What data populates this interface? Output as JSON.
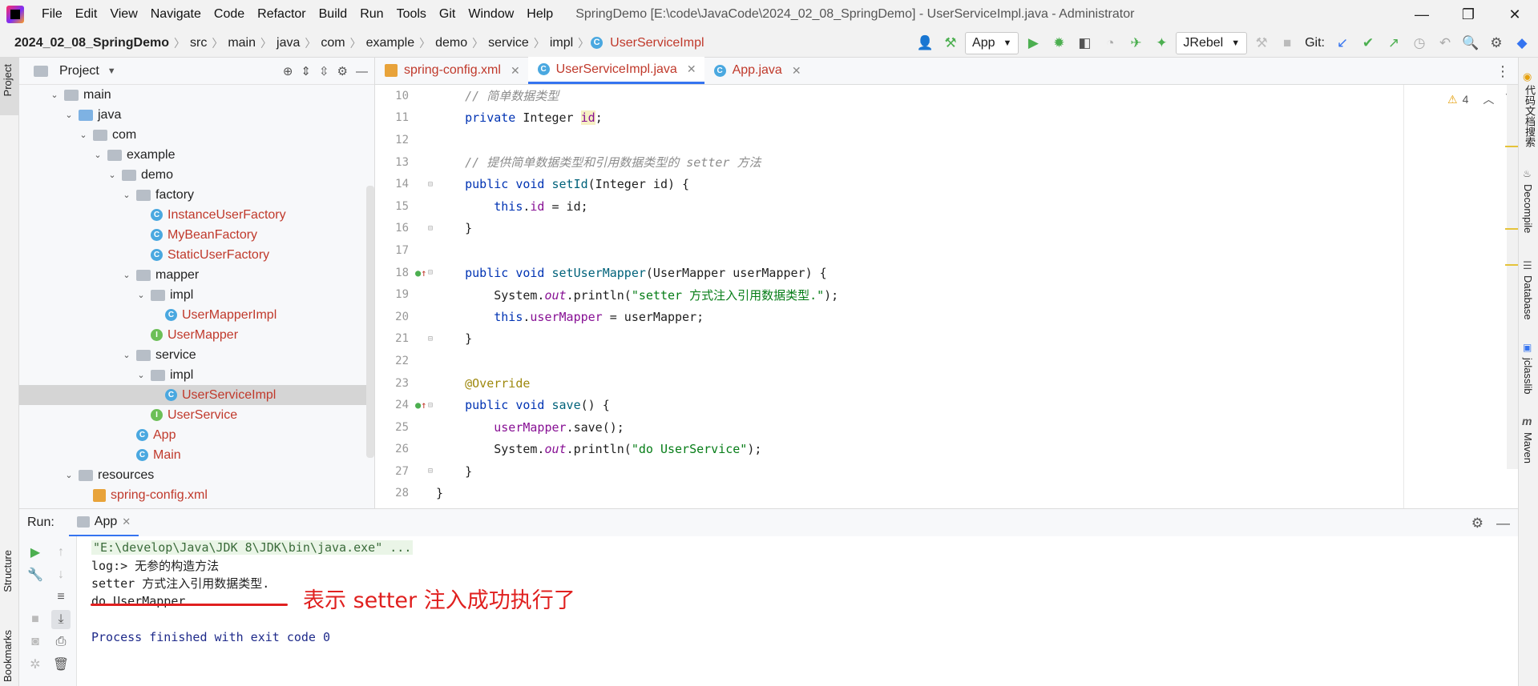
{
  "menu": [
    "File",
    "Edit",
    "View",
    "Navigate",
    "Code",
    "Refactor",
    "Build",
    "Run",
    "Tools",
    "Git",
    "Window",
    "Help"
  ],
  "window_title": "SpringDemo [E:\\code\\JavaCode\\2024_02_08_SpringDemo] - UserServiceImpl.java - Administrator",
  "window_controls": {
    "minimize": "—",
    "restore": "❐",
    "close": "✕"
  },
  "breadcrumb": [
    "2024_02_08_SpringDemo",
    "src",
    "main",
    "java",
    "com",
    "example",
    "demo",
    "service",
    "impl",
    "UserServiceImpl"
  ],
  "toolbar": {
    "run_config": "App",
    "jrebel": "JRebel",
    "git_label": "Git:"
  },
  "project_panel": {
    "title": "Project",
    "tree": [
      {
        "label": "main",
        "type": "folder",
        "level": 1,
        "expanded": true
      },
      {
        "label": "java",
        "type": "folder-blue",
        "level": 2,
        "expanded": true
      },
      {
        "label": "com",
        "type": "folder",
        "level": 3,
        "expanded": true
      },
      {
        "label": "example",
        "type": "folder",
        "level": 4,
        "expanded": true
      },
      {
        "label": "demo",
        "type": "folder",
        "level": 5,
        "expanded": true
      },
      {
        "label": "factory",
        "type": "folder",
        "level": 6,
        "expanded": true
      },
      {
        "label": "InstanceUserFactory",
        "type": "class",
        "level": 7
      },
      {
        "label": "MyBeanFactory",
        "type": "class",
        "level": 7
      },
      {
        "label": "StaticUserFactory",
        "type": "class",
        "level": 7
      },
      {
        "label": "mapper",
        "type": "folder",
        "level": 6,
        "expanded": true
      },
      {
        "label": "impl",
        "type": "folder",
        "level": 7,
        "expanded": true
      },
      {
        "label": "UserMapperImpl",
        "type": "class",
        "level": 8
      },
      {
        "label": "UserMapper",
        "type": "interface",
        "level": 7
      },
      {
        "label": "service",
        "type": "folder",
        "level": 6,
        "expanded": true
      },
      {
        "label": "impl",
        "type": "folder",
        "level": 7,
        "expanded": true
      },
      {
        "label": "UserServiceImpl",
        "type": "class",
        "level": 8,
        "selected": true
      },
      {
        "label": "UserService",
        "type": "interface",
        "level": 7
      },
      {
        "label": "App",
        "type": "class-main",
        "level": 6
      },
      {
        "label": "Main",
        "type": "class-main",
        "level": 6
      },
      {
        "label": "resources",
        "type": "folder",
        "level": 2,
        "expanded": true
      },
      {
        "label": "spring-config.xml",
        "type": "xml",
        "level": 3
      }
    ]
  },
  "editor_tabs": [
    {
      "label": "spring-config.xml",
      "active": false
    },
    {
      "label": "UserServiceImpl.java",
      "active": true
    },
    {
      "label": "App.java",
      "active": false
    }
  ],
  "problems_count": "4",
  "code_lines": [
    {
      "n": "10",
      "html": "    <span class=\"cm\">// 简单数据类型</span>"
    },
    {
      "n": "11",
      "html": "    <span class=\"kw\">private</span> Integer <span class=\"field hl-id\">id</span>;"
    },
    {
      "n": "12",
      "html": ""
    },
    {
      "n": "13",
      "html": "    <span class=\"cm\">// 提供简单数据类型和引用数据类型的 setter 方法</span>"
    },
    {
      "n": "14",
      "html": "    <span class=\"kw\">public void</span> <span class=\"fn\">setId</span>(Integer id) {"
    },
    {
      "n": "15",
      "html": "        <span class=\"kw\">this</span>.<span class=\"field\">id</span> = id;"
    },
    {
      "n": "16",
      "html": "    }"
    },
    {
      "n": "17",
      "html": ""
    },
    {
      "n": "18",
      "html": "    <span class=\"kw\">public void</span> <span class=\"fn\">setUserMapper</span>(UserMapper userMapper) {"
    },
    {
      "n": "19",
      "html": "        System.<span class=\"static\">out</span>.println(<span class=\"str\">\"setter 方式注入引用数据类型.\"</span>);"
    },
    {
      "n": "20",
      "html": "        <span class=\"kw\">this</span>.<span class=\"field\">userMapper</span> = userMapper;"
    },
    {
      "n": "21",
      "html": "    }"
    },
    {
      "n": "22",
      "html": ""
    },
    {
      "n": "23",
      "html": "    <span class=\"ann\">@Override</span>"
    },
    {
      "n": "24",
      "html": "    <span class=\"kw\">public void</span> <span class=\"fn\">save</span>() {"
    },
    {
      "n": "25",
      "html": "        <span class=\"field\">userMapper</span>.save();"
    },
    {
      "n": "26",
      "html": "        System.<span class=\"static\">out</span>.println(<span class=\"str\">\"do UserService\"</span>);"
    },
    {
      "n": "27",
      "html": "    }"
    },
    {
      "n": "28",
      "html": "}"
    }
  ],
  "run_panel": {
    "label": "Run:",
    "tab": "App",
    "console": [
      "\"E:\\develop\\Java\\JDK 8\\JDK\\bin\\java.exe\" ...",
      "log:> 无参的构造方法",
      "setter 方式注入引用数据类型.",
      "do UserMapper",
      "",
      "Process finished with exit code 0"
    ]
  },
  "annotation": "表示 setter 注入成功执行了",
  "side_labels": {
    "project": "Project",
    "structure": "Structure",
    "bookmarks": "Bookmarks",
    "search": "代码文档搜索",
    "decompile": "Decompile",
    "database": "Database",
    "jclasslib": "jclasslib",
    "maven": "Maven"
  },
  "colors": {
    "accent": "#3574f0",
    "annotation_red": "#e0201f",
    "class_name_red": "#c0392b"
  }
}
